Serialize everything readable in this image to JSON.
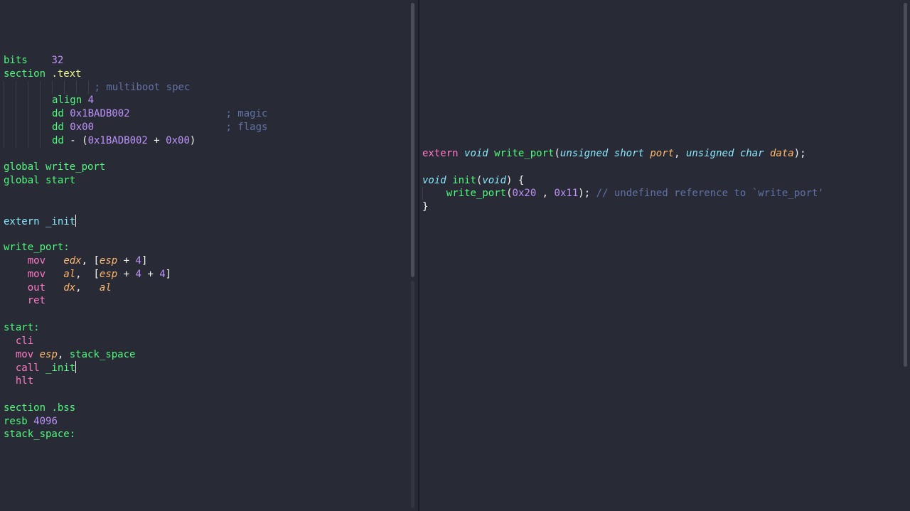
{
  "left_editor": {
    "language": "asm",
    "lines": [
      {
        "tokens": [
          {
            "t": "bits",
            "c": "kw"
          },
          {
            "t": "    ",
            "c": "plain"
          },
          {
            "t": "32",
            "c": "num"
          }
        ]
      },
      {
        "tokens": [
          {
            "t": "section",
            "c": "kw"
          },
          {
            "t": " .text",
            "c": "str"
          }
        ]
      },
      {
        "guides": 15,
        "tokens": [
          {
            "t": "; multiboot spec",
            "c": "cmt"
          }
        ]
      },
      {
        "guides": 8,
        "tokens": [
          {
            "t": "align",
            "c": "kw"
          },
          {
            "t": " ",
            "c": "plain"
          },
          {
            "t": "4",
            "c": "num"
          }
        ]
      },
      {
        "guides": 8,
        "tokens": [
          {
            "t": "dd",
            "c": "kw"
          },
          {
            "t": " ",
            "c": "plain"
          },
          {
            "t": "0x1BADB002",
            "c": "num"
          },
          {
            "t": "                ",
            "c": "plain"
          },
          {
            "t": "; magic",
            "c": "cmt"
          }
        ]
      },
      {
        "guides": 8,
        "tokens": [
          {
            "t": "dd",
            "c": "kw"
          },
          {
            "t": " ",
            "c": "plain"
          },
          {
            "t": "0x00",
            "c": "num"
          },
          {
            "t": "                      ",
            "c": "plain"
          },
          {
            "t": "; flags",
            "c": "cmt"
          }
        ]
      },
      {
        "guides": 8,
        "tokens": [
          {
            "t": "dd",
            "c": "kw"
          },
          {
            "t": " - (",
            "c": "plain"
          },
          {
            "t": "0x1BADB002",
            "c": "num"
          },
          {
            "t": " + ",
            "c": "plain"
          },
          {
            "t": "0x00",
            "c": "num"
          },
          {
            "t": ")",
            "c": "plain"
          }
        ]
      },
      {
        "tokens": []
      },
      {
        "tokens": [
          {
            "t": "global",
            "c": "kw"
          },
          {
            "t": " write_port",
            "c": "kw"
          }
        ]
      },
      {
        "tokens": [
          {
            "t": "global",
            "c": "kw"
          },
          {
            "t": " start",
            "c": "kw"
          }
        ]
      },
      {
        "tokens": []
      },
      {
        "tokens": []
      },
      {
        "tokens": [
          {
            "t": "extern",
            "c": "lbl"
          },
          {
            "t": " _init",
            "c": "lbl"
          }
        ],
        "caret": true
      },
      {
        "tokens": []
      },
      {
        "tokens": [
          {
            "t": "write_port:",
            "c": "kw"
          }
        ]
      },
      {
        "tokens": [
          {
            "t": "    ",
            "c": "plain"
          },
          {
            "t": "mov",
            "c": "pink"
          },
          {
            "t": "   ",
            "c": "plain"
          },
          {
            "t": "edx",
            "c": "reg"
          },
          {
            "t": ", [",
            "c": "plain"
          },
          {
            "t": "esp",
            "c": "reg"
          },
          {
            "t": " + ",
            "c": "plain"
          },
          {
            "t": "4",
            "c": "num"
          },
          {
            "t": "]",
            "c": "plain"
          }
        ]
      },
      {
        "tokens": [
          {
            "t": "    ",
            "c": "plain"
          },
          {
            "t": "mov",
            "c": "pink"
          },
          {
            "t": "   ",
            "c": "plain"
          },
          {
            "t": "al",
            "c": "reg"
          },
          {
            "t": ",  [",
            "c": "plain"
          },
          {
            "t": "esp",
            "c": "reg"
          },
          {
            "t": " + ",
            "c": "plain"
          },
          {
            "t": "4",
            "c": "num"
          },
          {
            "t": " + ",
            "c": "plain"
          },
          {
            "t": "4",
            "c": "num"
          },
          {
            "t": "]",
            "c": "plain"
          }
        ]
      },
      {
        "tokens": [
          {
            "t": "    ",
            "c": "plain"
          },
          {
            "t": "out",
            "c": "pink"
          },
          {
            "t": "   ",
            "c": "plain"
          },
          {
            "t": "dx",
            "c": "reg"
          },
          {
            "t": ",   ",
            "c": "plain"
          },
          {
            "t": "al",
            "c": "reg"
          }
        ]
      },
      {
        "tokens": [
          {
            "t": "    ",
            "c": "plain"
          },
          {
            "t": "ret",
            "c": "pink"
          }
        ]
      },
      {
        "tokens": []
      },
      {
        "tokens": [
          {
            "t": "start:",
            "c": "kw"
          }
        ]
      },
      {
        "tokens": [
          {
            "t": "  ",
            "c": "plain"
          },
          {
            "t": "cli",
            "c": "pink"
          }
        ]
      },
      {
        "tokens": [
          {
            "t": "  ",
            "c": "plain"
          },
          {
            "t": "mov",
            "c": "pink"
          },
          {
            "t": " ",
            "c": "plain"
          },
          {
            "t": "esp",
            "c": "reg"
          },
          {
            "t": ", ",
            "c": "plain"
          },
          {
            "t": "stack_space",
            "c": "kw"
          }
        ]
      },
      {
        "tokens": [
          {
            "t": "  ",
            "c": "plain"
          },
          {
            "t": "call",
            "c": "pink"
          },
          {
            "t": " _init",
            "c": "kw"
          }
        ],
        "caret": true
      },
      {
        "tokens": [
          {
            "t": "  ",
            "c": "plain"
          },
          {
            "t": "hlt",
            "c": "pink"
          }
        ]
      },
      {
        "tokens": []
      },
      {
        "tokens": [
          {
            "t": "section",
            "c": "kw"
          },
          {
            "t": " .bss",
            "c": "kw"
          }
        ]
      },
      {
        "tokens": [
          {
            "t": "resb",
            "c": "kw"
          },
          {
            "t": " ",
            "c": "plain"
          },
          {
            "t": "4096",
            "c": "num"
          }
        ]
      },
      {
        "tokens": [
          {
            "t": "stack_space:",
            "c": "kw"
          }
        ]
      }
    ]
  },
  "right_editor": {
    "language": "c",
    "lines": [
      {
        "tokens": [
          {
            "t": "extern",
            "c": "pink"
          },
          {
            "t": " ",
            "c": "plain"
          },
          {
            "t": "void",
            "c": "type"
          },
          {
            "t": " ",
            "c": "plain"
          },
          {
            "t": "write_port",
            "c": "fn"
          },
          {
            "t": "(",
            "c": "plain"
          },
          {
            "t": "unsigned",
            "c": "type"
          },
          {
            "t": " ",
            "c": "plain"
          },
          {
            "t": "short",
            "c": "type"
          },
          {
            "t": " ",
            "c": "plain"
          },
          {
            "t": "port",
            "c": "param"
          },
          {
            "t": ", ",
            "c": "plain"
          },
          {
            "t": "unsigned",
            "c": "type"
          },
          {
            "t": " ",
            "c": "plain"
          },
          {
            "t": "char",
            "c": "type"
          },
          {
            "t": " ",
            "c": "plain"
          },
          {
            "t": "data",
            "c": "param"
          },
          {
            "t": ");",
            "c": "plain"
          }
        ]
      },
      {
        "tokens": []
      },
      {
        "tokens": [
          {
            "t": "void",
            "c": "type"
          },
          {
            "t": " ",
            "c": "plain"
          },
          {
            "t": "init",
            "c": "fn"
          },
          {
            "t": "(",
            "c": "plain"
          },
          {
            "t": "void",
            "c": "type"
          },
          {
            "t": ") {",
            "c": "plain"
          }
        ]
      },
      {
        "guides": 1,
        "tokens": [
          {
            "t": "   ",
            "c": "plain"
          },
          {
            "t": "write_port",
            "c": "fn"
          },
          {
            "t": "(",
            "c": "plain"
          },
          {
            "t": "0x20",
            "c": "num"
          },
          {
            "t": " , ",
            "c": "plain"
          },
          {
            "t": "0x11",
            "c": "num"
          },
          {
            "t": "); ",
            "c": "plain"
          },
          {
            "t": "// undefined reference to `write_port'",
            "c": "cmt"
          }
        ]
      },
      {
        "tokens": [
          {
            "t": "}",
            "c": "plain"
          }
        ]
      }
    ]
  },
  "colors": {
    "background": "#282a36",
    "green": "#50fa7b",
    "pink": "#ff79c6",
    "purple": "#bd93f9",
    "cyan": "#8be9fd",
    "orange": "#ffb86c",
    "comment": "#6272a4",
    "foreground": "#f8f8f2"
  }
}
